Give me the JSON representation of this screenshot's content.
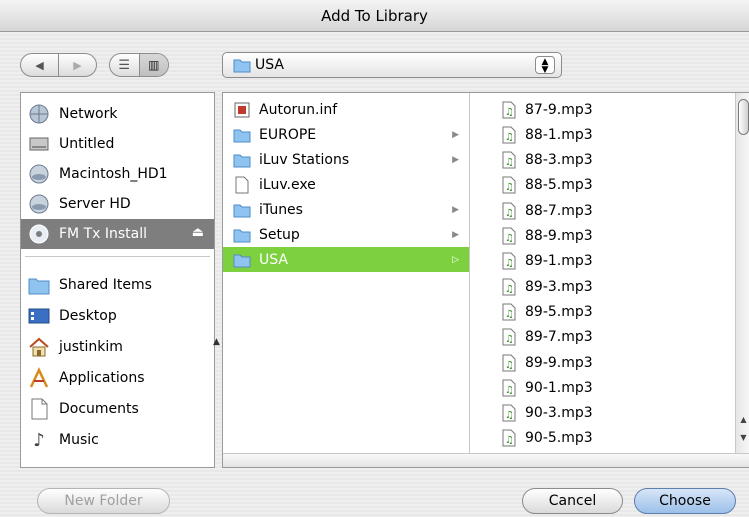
{
  "window": {
    "title": "Add To Library"
  },
  "toolbar": {
    "back_icon": "back-arrow-icon",
    "forward_icon": "forward-arrow-icon",
    "list_view_icon": "list-view-icon",
    "column_view_icon": "column-view-icon",
    "location": "USA"
  },
  "sidebar": {
    "devices": [
      {
        "label": "Network",
        "icon": "network-icon"
      },
      {
        "label": "Untitled",
        "icon": "drive-icon"
      },
      {
        "label": "Macintosh_HD1",
        "icon": "disk-icon"
      },
      {
        "label": "Server HD",
        "icon": "disk-icon"
      },
      {
        "label": "FM Tx Install",
        "icon": "cd-icon",
        "selected": true
      }
    ],
    "places": [
      {
        "label": "Shared Items",
        "icon": "folder-icon"
      },
      {
        "label": "Desktop",
        "icon": "desktop-icon"
      },
      {
        "label": "justinkim",
        "icon": "home-icon"
      },
      {
        "label": "Applications",
        "icon": "applications-icon"
      },
      {
        "label": "Documents",
        "icon": "documents-icon"
      },
      {
        "label": "Music",
        "icon": "music-icon"
      }
    ]
  },
  "columns": {
    "col1": [
      {
        "name": "Autorun.inf",
        "type": "file"
      },
      {
        "name": "EUROPE",
        "type": "folder"
      },
      {
        "name": "iLuv Stations",
        "type": "folder"
      },
      {
        "name": "iLuv.exe",
        "type": "file"
      },
      {
        "name": "iTunes",
        "type": "folder"
      },
      {
        "name": "Setup",
        "type": "folder"
      },
      {
        "name": "USA",
        "type": "folder",
        "selected": true
      }
    ],
    "col2": [
      "87-9.mp3",
      "88-1.mp3",
      "88-3.mp3",
      "88-5.mp3",
      "88-7.mp3",
      "88-9.mp3",
      "89-1.mp3",
      "89-3.mp3",
      "89-5.mp3",
      "89-7.mp3",
      "89-9.mp3",
      "90-1.mp3",
      "90-3.mp3",
      "90-5.mp3"
    ]
  },
  "buttons": {
    "new_folder": "New Folder",
    "cancel": "Cancel",
    "choose": "Choose"
  },
  "colors": {
    "selection_green": "#7dd13f",
    "sidebar_selected": "#7e7e7e"
  }
}
